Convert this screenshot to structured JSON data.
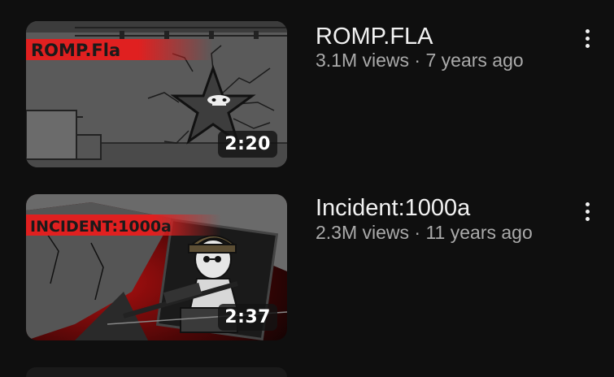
{
  "videos": [
    {
      "banner_text": "ROMP.Fla",
      "duration": "2:20",
      "title": "ROMP.FLA",
      "views": "3.1M views",
      "age": "7 years ago",
      "meta": "3.1M views · 7 years ago"
    },
    {
      "banner_text": "INCIDENT:1000a",
      "duration": "2:37",
      "title": "Incident:1000a",
      "views": "2.3M views",
      "age": "11 years ago",
      "meta": "2.3M views · 11 years ago"
    }
  ],
  "colors": {
    "background": "#0f0f0f",
    "title": "#f1f1f1",
    "meta": "#aaaaaa",
    "banner_red": "#e02020"
  },
  "icons": {
    "more": "more-vert-icon"
  }
}
